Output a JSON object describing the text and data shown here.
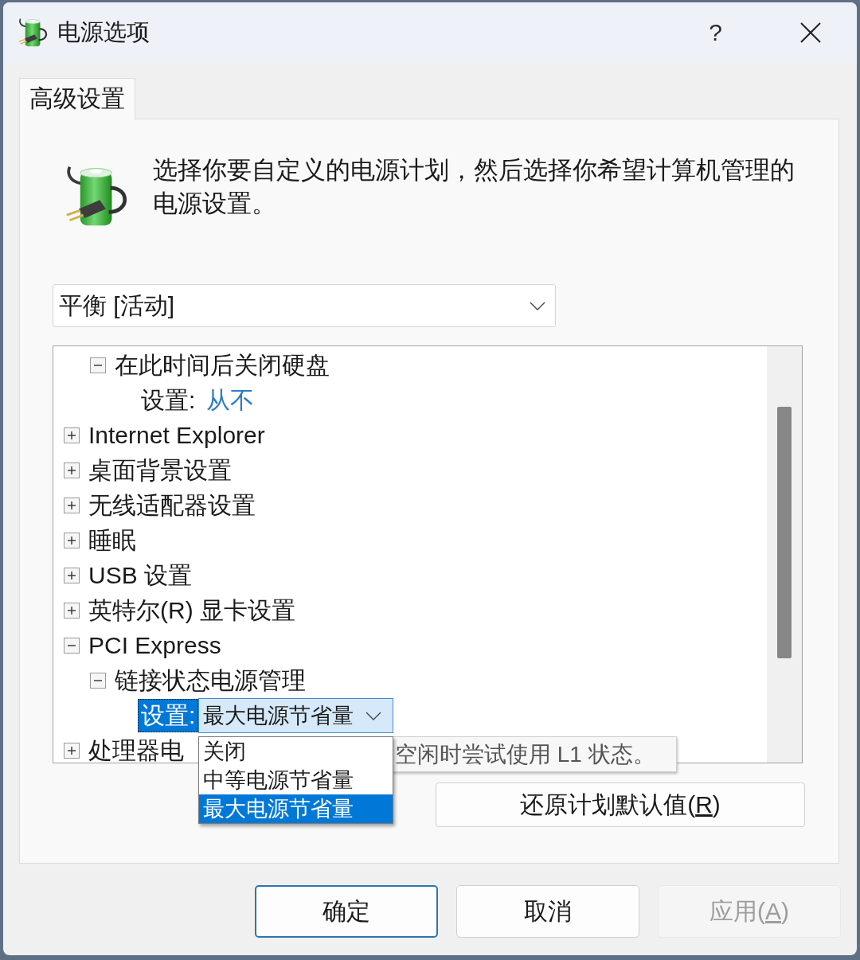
{
  "window": {
    "title": "电源选项",
    "help_button": "?"
  },
  "tabs": [
    {
      "label": "高级设置",
      "selected": true
    }
  ],
  "intro": {
    "text": "选择你要自定义的电源计划，然后选择你希望计算机管理的电源设置。"
  },
  "plan_select": {
    "value": "平衡 [活动]"
  },
  "tree": {
    "items": [
      {
        "kind": "group",
        "children": [
          {
            "kind": "group",
            "label": "在此时间后关闭硬盘",
            "expanded": true,
            "selected": false,
            "children": [
              {
                "kind": "setting",
                "label": "设置:",
                "value": "从不",
                "selected": false
              }
            ]
          }
        ]
      },
      {
        "kind": "group",
        "label": "Internet Explorer",
        "expanded": false,
        "selected": false
      },
      {
        "kind": "group",
        "label": "桌面背景设置",
        "expanded": false,
        "selected": false
      },
      {
        "kind": "group",
        "label": "无线适配器设置",
        "expanded": false,
        "selected": false
      },
      {
        "kind": "group",
        "label": "睡眠",
        "expanded": false,
        "selected": false
      },
      {
        "kind": "group",
        "label": "USB 设置",
        "expanded": false,
        "selected": false
      },
      {
        "kind": "group",
        "label": "英特尔(R) 显卡设置",
        "expanded": false,
        "selected": false
      },
      {
        "kind": "group",
        "label": "PCI Express",
        "expanded": true,
        "selected": false,
        "children": [
          {
            "kind": "group",
            "label": "链接状态电源管理",
            "expanded": true,
            "selected": false,
            "children": [
              {
                "kind": "setting",
                "label": "设置:",
                "value": "最大电源节省量",
                "selected": true,
                "open": true,
                "options": [
                  {
                    "label": "关闭",
                    "selected": false
                  },
                  {
                    "label": "中等电源节省量",
                    "selected": false
                  },
                  {
                    "label": "最大电源节省量",
                    "selected": true
                  }
                ]
              }
            ]
          }
        ]
      },
      {
        "kind": "group",
        "label": "处理器电",
        "expanded": false,
        "selected": false
      }
    ]
  },
  "tooltip": {
    "text": "空闲时尝试使用 L1 状态。"
  },
  "restore_button": {
    "label": "还原计划默认值(",
    "access_key": "R",
    "label_end": ")"
  },
  "buttons": [
    {
      "label": "确定",
      "default": true,
      "disabled": false
    },
    {
      "label": "取消",
      "default": false,
      "disabled": false
    },
    {
      "label": "应用(",
      "access_key": "A",
      "label_end": ")",
      "default": false,
      "disabled": true
    }
  ]
}
